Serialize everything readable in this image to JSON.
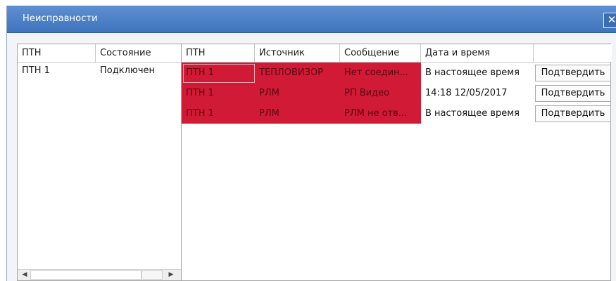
{
  "window": {
    "title": "Неисправности",
    "close_symbol": "✕"
  },
  "left_table": {
    "headers": [
      "ПТН",
      "Состояние"
    ],
    "rows": [
      {
        "ptn": "ПТН 1",
        "state": "Подключен"
      }
    ],
    "scroll": {
      "left_arrow": "◀",
      "right_arrow": "▶"
    }
  },
  "fault_table": {
    "headers": [
      "ПТН",
      "Источник",
      "Сообщение",
      "Дата и время",
      ""
    ],
    "rows": [
      {
        "ptn": "ПТН 1",
        "source": "ТЕПЛОВИЗОР",
        "message": "Нет соедин...",
        "datetime": "В настоящее время",
        "action": "Подтвердить"
      },
      {
        "ptn": "ПТН 1",
        "source": "РЛМ",
        "message": "РП Видео",
        "datetime": "14:18 12/05/2017",
        "action": "Подтвердить"
      },
      {
        "ptn": "ПТН 1",
        "source": "РЛМ",
        "message": "РЛМ не отв...",
        "datetime": "В настоящее время",
        "action": "Подтвердить"
      }
    ],
    "highlight_color": "#d11a35"
  }
}
